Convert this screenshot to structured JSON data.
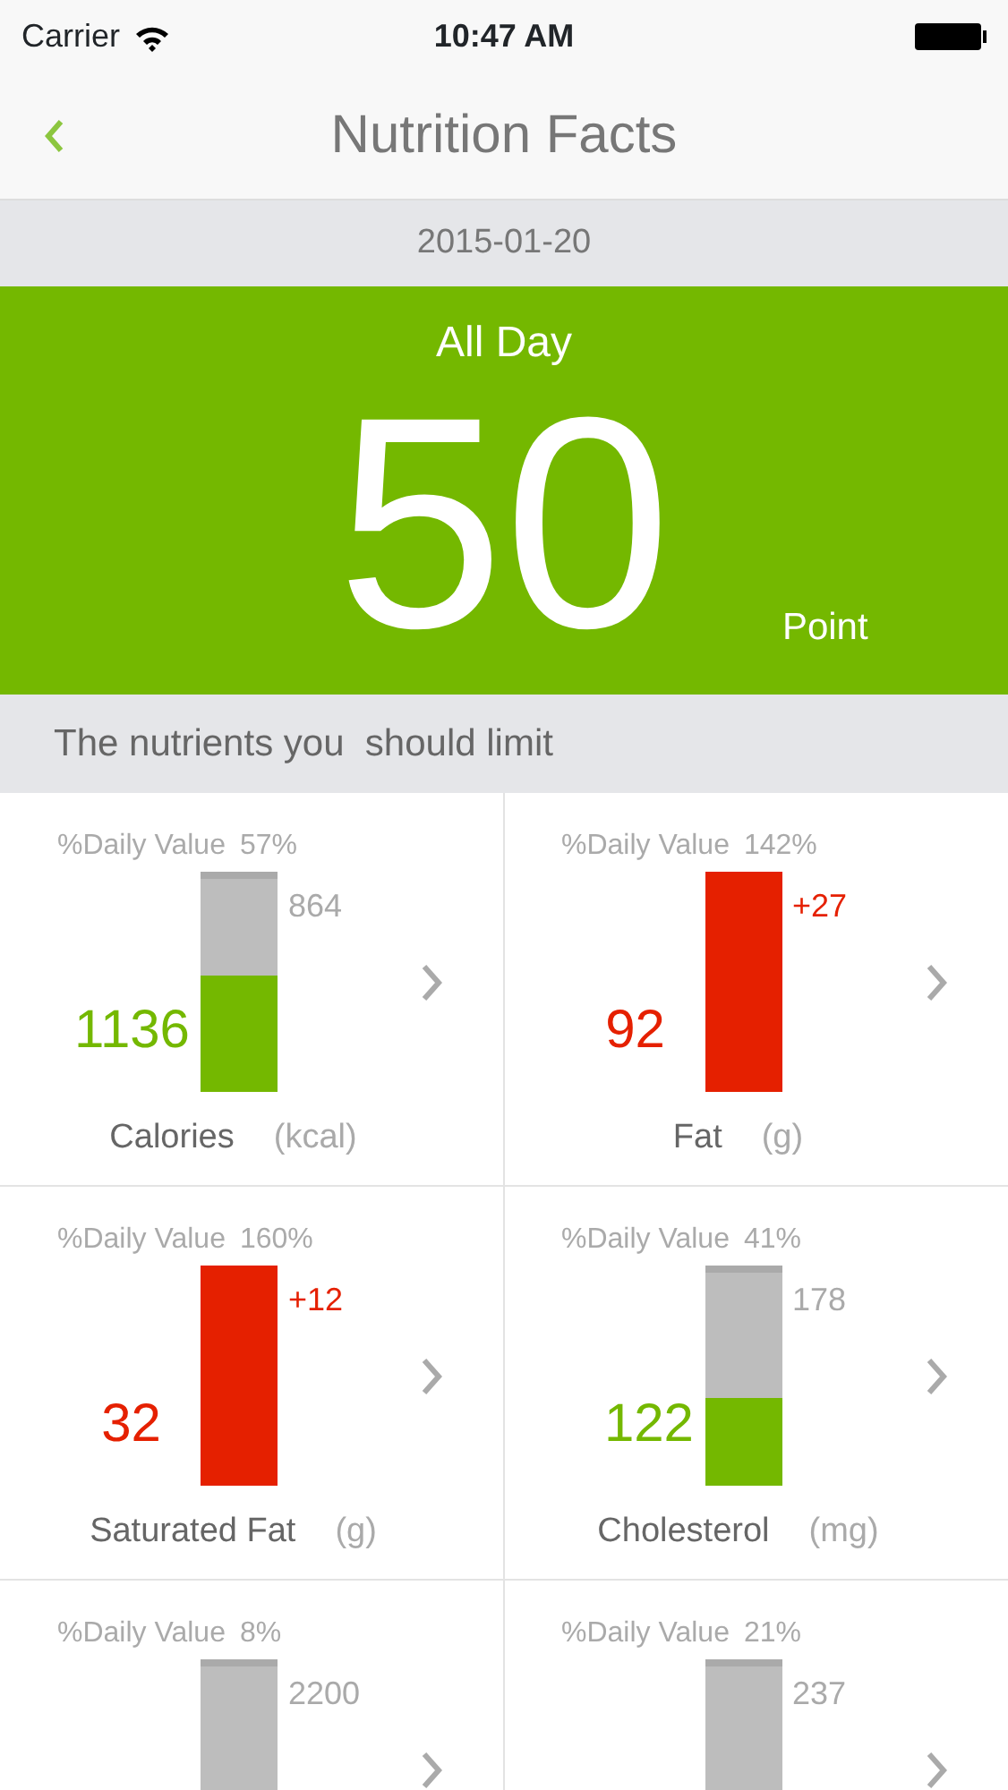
{
  "status_bar": {
    "carrier": "Carrier",
    "time": "10:47 AM"
  },
  "nav": {
    "title": "Nutrition Facts"
  },
  "date": "2015-01-20",
  "score": {
    "period": "All Day",
    "value": "50",
    "unit": "Point"
  },
  "section": {
    "title": "The nutrients you  should limit"
  },
  "nutrients": [
    {
      "kind": "under",
      "dv_label": "%Daily Value",
      "dv_percent": "57%",
      "amount": "1136",
      "remaining": "864",
      "level": 0.55,
      "name": "Calories",
      "unit": "(kcal)"
    },
    {
      "kind": "over",
      "dv_label": "%Daily Value",
      "dv_percent": "142%",
      "amount": "92",
      "excess": "+27",
      "name": "Fat",
      "unit": "(g)"
    },
    {
      "kind": "over",
      "dv_label": "%Daily Value",
      "dv_percent": "160%",
      "amount": "32",
      "excess": "+12",
      "name": "Saturated Fat",
      "unit": "(g)"
    },
    {
      "kind": "under",
      "dv_label": "%Daily Value",
      "dv_percent": "41%",
      "amount": "122",
      "remaining": "178",
      "level": 0.41,
      "name": "Cholesterol",
      "unit": "(mg)"
    },
    {
      "kind": "under",
      "dv_label": "%Daily Value",
      "dv_percent": "8%",
      "remaining": "2200"
    },
    {
      "kind": "under",
      "dv_label": "%Daily Value",
      "dv_percent": "21%",
      "remaining": "237"
    }
  ]
}
